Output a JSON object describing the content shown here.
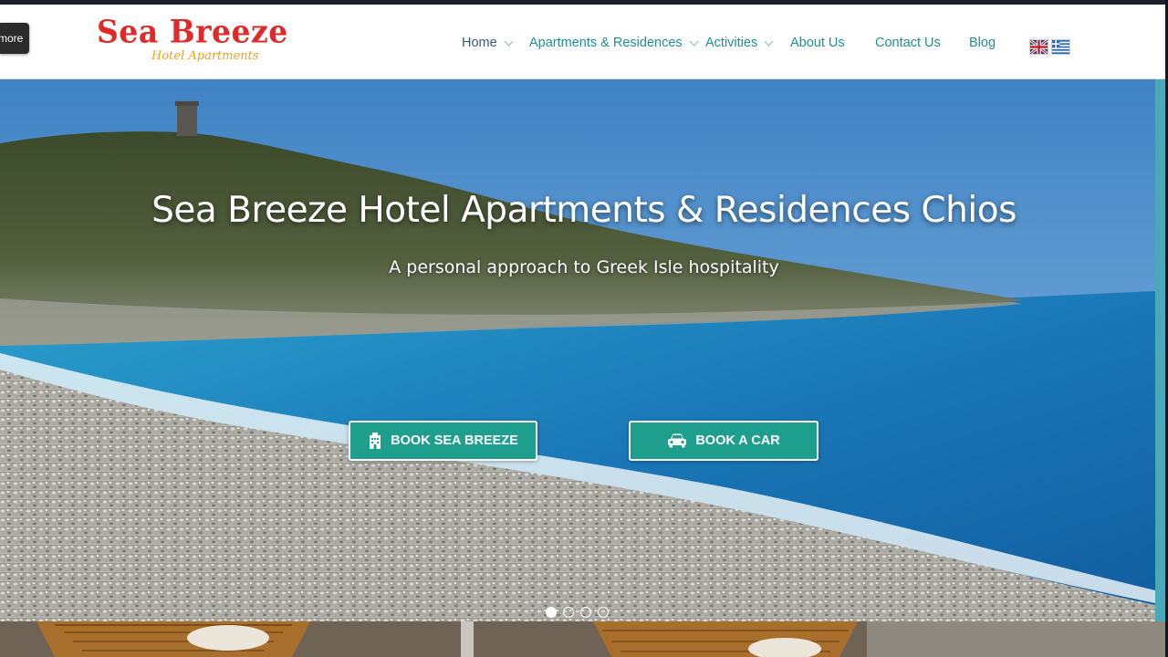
{
  "header": {
    "more_tab": "more",
    "logo_main": "Sea Breeze",
    "logo_sub": "Hotel Apartments"
  },
  "nav": {
    "items": [
      {
        "label": "Home",
        "dropdown": true,
        "active": true
      },
      {
        "label": "Apartments & Residences",
        "dropdown": true
      },
      {
        "label": "Activities",
        "dropdown": true
      },
      {
        "label": "About Us",
        "dropdown": false
      },
      {
        "label": "Contact Us",
        "dropdown": false
      },
      {
        "label": "Blog",
        "dropdown": false
      }
    ],
    "flags": [
      "flag-uk-icon",
      "flag-greece-icon"
    ]
  },
  "hero": {
    "title": "Sea Breeze Hotel Apartments & Residences Chios",
    "subtitle": "A personal approach to Greek Isle hospitality",
    "buttons": [
      {
        "label": "BOOK SEA BREEZE",
        "icon": "building-icon"
      },
      {
        "label": "BOOK A CAR",
        "icon": "car-icon"
      }
    ],
    "slides": 4,
    "active_slide": 1
  },
  "colors": {
    "nav_text": "#1f8f93",
    "nav_active": "#3e5a6a",
    "logo_red": "#e02a2a",
    "logo_orange": "#f0a020",
    "button_bg": "#1e9e8c"
  }
}
